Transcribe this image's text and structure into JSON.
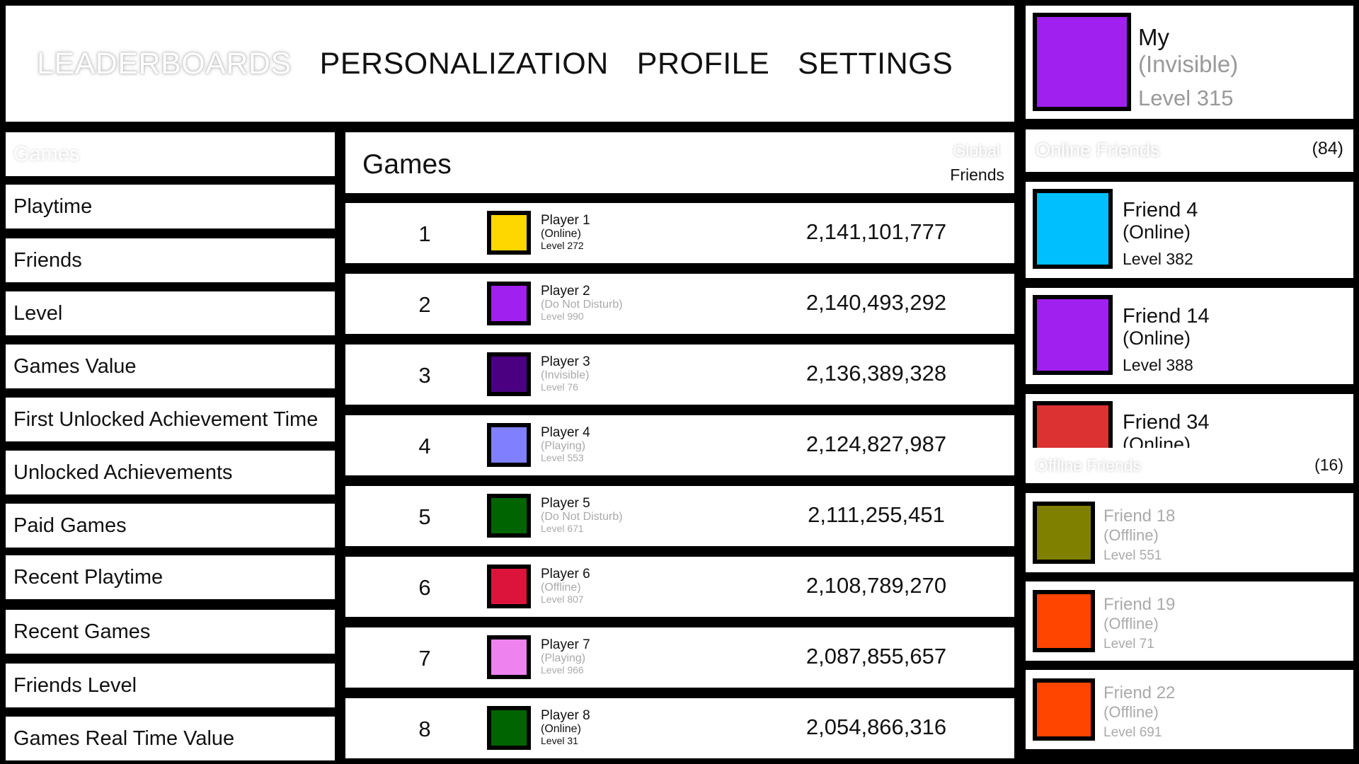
{
  "nav": {
    "items": [
      "LEADERBOARDS",
      "PERSONALIZATION",
      "PROFILE",
      "SETTINGS"
    ],
    "active": "LEADERBOARDS"
  },
  "profile": {
    "name": "My",
    "status": "(Invisible)",
    "level": "Level 315",
    "avatar_color": "#a020f0"
  },
  "categories": {
    "header": "Games",
    "items": [
      "Playtime",
      "Friends",
      "Level",
      "Games Value",
      "First Unlocked Achievement Time",
      "Unlocked Achievements",
      "Paid Games",
      "Recent Playtime",
      "Recent Games",
      "Friends Level",
      "Games Real Time Value"
    ]
  },
  "leaderboard": {
    "title": "Games",
    "scope_options": [
      "Global",
      "Friends"
    ],
    "rows": [
      {
        "rank": "1",
        "name": "Player 1",
        "status": "(Online)",
        "level": "Level 272",
        "score": "2,141,101,777",
        "color": "#ffd700",
        "status_color": "#111"
      },
      {
        "rank": "2",
        "name": "Player 2",
        "status": "(Do Not Disturb)",
        "level": "Level 990",
        "score": "2,140,493,292",
        "color": "#a020f0",
        "status_color": "#aaa"
      },
      {
        "rank": "3",
        "name": "Player 3",
        "status": "(Invisible)",
        "level": "Level 76",
        "score": "2,136,389,328",
        "color": "#4b0082",
        "status_color": "#aaa"
      },
      {
        "rank": "4",
        "name": "Player 4",
        "status": "(Playing)",
        "level": "Level 553",
        "score": "2,124,827,987",
        "color": "#8080ff",
        "status_color": "#aaa"
      },
      {
        "rank": "5",
        "name": "Player 5",
        "status": "(Do Not Disturb)",
        "level": "Level 671",
        "score": "2,111,255,451",
        "color": "#006400",
        "status_color": "#aaa"
      },
      {
        "rank": "6",
        "name": "Player 6",
        "status": "(Offline)",
        "level": "Level 807",
        "score": "2,108,789,270",
        "color": "#dc143c",
        "status_color": "#aaa"
      },
      {
        "rank": "7",
        "name": "Player 7",
        "status": "(Playing)",
        "level": "Level 966",
        "score": "2,087,855,657",
        "color": "#ee82ee",
        "status_color": "#aaa"
      },
      {
        "rank": "8",
        "name": "Player 8",
        "status": "(Online)",
        "level": "Level 31",
        "score": "2,054,866,316",
        "color": "#006400",
        "status_color": "#111"
      }
    ]
  },
  "online_friends": {
    "label": "Online Friends",
    "count": "(84)",
    "items": [
      {
        "name": "Friend 4",
        "status": "(Online)",
        "level": "Level 382",
        "color": "#00bfff"
      },
      {
        "name": "Friend 14",
        "status": "(Online)",
        "level": "Level 388",
        "color": "#a020f0"
      },
      {
        "name": "Friend 34",
        "status": "(Online)",
        "level": "",
        "color": "#dc3232"
      }
    ]
  },
  "offline_friends": {
    "label": "Offline Friends",
    "count": "(16)",
    "items": [
      {
        "name": "Friend 18",
        "status": "(Offline)",
        "level": "Level 551",
        "color": "#808000"
      },
      {
        "name": "Friend 19",
        "status": "(Offline)",
        "level": "Level 71",
        "color": "#ff4500"
      },
      {
        "name": "Friend 22",
        "status": "(Offline)",
        "level": "Level 691",
        "color": "#ff4500"
      }
    ]
  }
}
